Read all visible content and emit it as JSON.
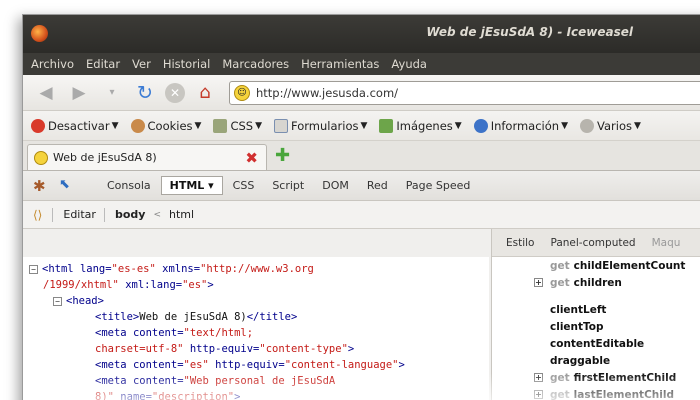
{
  "window": {
    "title": "Web de jEsuSdA 8) - Iceweasel"
  },
  "menu": [
    "Archivo",
    "Editar",
    "Ver",
    "Historial",
    "Marcadores",
    "Herramientas",
    "Ayuda"
  ],
  "nav": {
    "url": "http://www.jesusda.com/"
  },
  "devtoolbar": [
    "Desactivar",
    "Cookies",
    "CSS",
    "Formularios",
    "Imágenes",
    "Información",
    "Varios"
  ],
  "tab": {
    "title": "Web de jEsuSdA 8)"
  },
  "firebug": {
    "tabs": [
      "Consola",
      "HTML",
      "CSS",
      "Script",
      "DOM",
      "Red",
      "Page Speed"
    ],
    "crumbs": {
      "edit": "Editar",
      "body": "body",
      "html": "html",
      "sep": "<"
    }
  },
  "html_code": {
    "l1_tag_open": "<html",
    "l1_a1": "lang=",
    "l1_v1": "\"es-es\"",
    "l1_a2": "xmlns=",
    "l1_v2": "\"http://www.w3.org",
    "l2_v2b": "/1999/xhtml\"",
    "l2_a3": "xml:lang=",
    "l2_v3": "\"es\"",
    "l2_close": ">",
    "l3": "<head>",
    "l4_open": "<title>",
    "l4_text": "Web de jEsuSdA 8)",
    "l4_close": "</title>",
    "l5_open": "<meta",
    "l5_a": "content=",
    "l5_v": "\"text/html;",
    "l6_v": "charset=utf-8\"",
    "l6_a": "http-equiv=",
    "l6_v2": "\"content-type\"",
    "l6_close": ">",
    "l7_open": "<meta",
    "l7_a": "content=",
    "l7_v": "\"es\"",
    "l7_a2": "http-equiv=",
    "l7_v2": "\"content-language\"",
    "l7_close": ">",
    "l8_open": "<meta",
    "l8_a": "content=",
    "l8_v": "\"Web personal de jEsuSdA",
    "l9_v": "8)\"",
    "l9_a": "name=",
    "l9_v2": "\"description\"",
    "l9_close": ">"
  },
  "right_panel": {
    "tabs": [
      "Estilo",
      "Panel-computed",
      "Maqu"
    ],
    "get_label": "get",
    "items": {
      "childElementCount": "childElementCount",
      "children": "children",
      "clientLeft": "clientLeft",
      "clientTop": "clientTop",
      "contentEditable": "contentEditable",
      "draggable": "draggable",
      "firstElementChild": "firstElementChild",
      "lastElementChild": "lastElementChild"
    }
  }
}
